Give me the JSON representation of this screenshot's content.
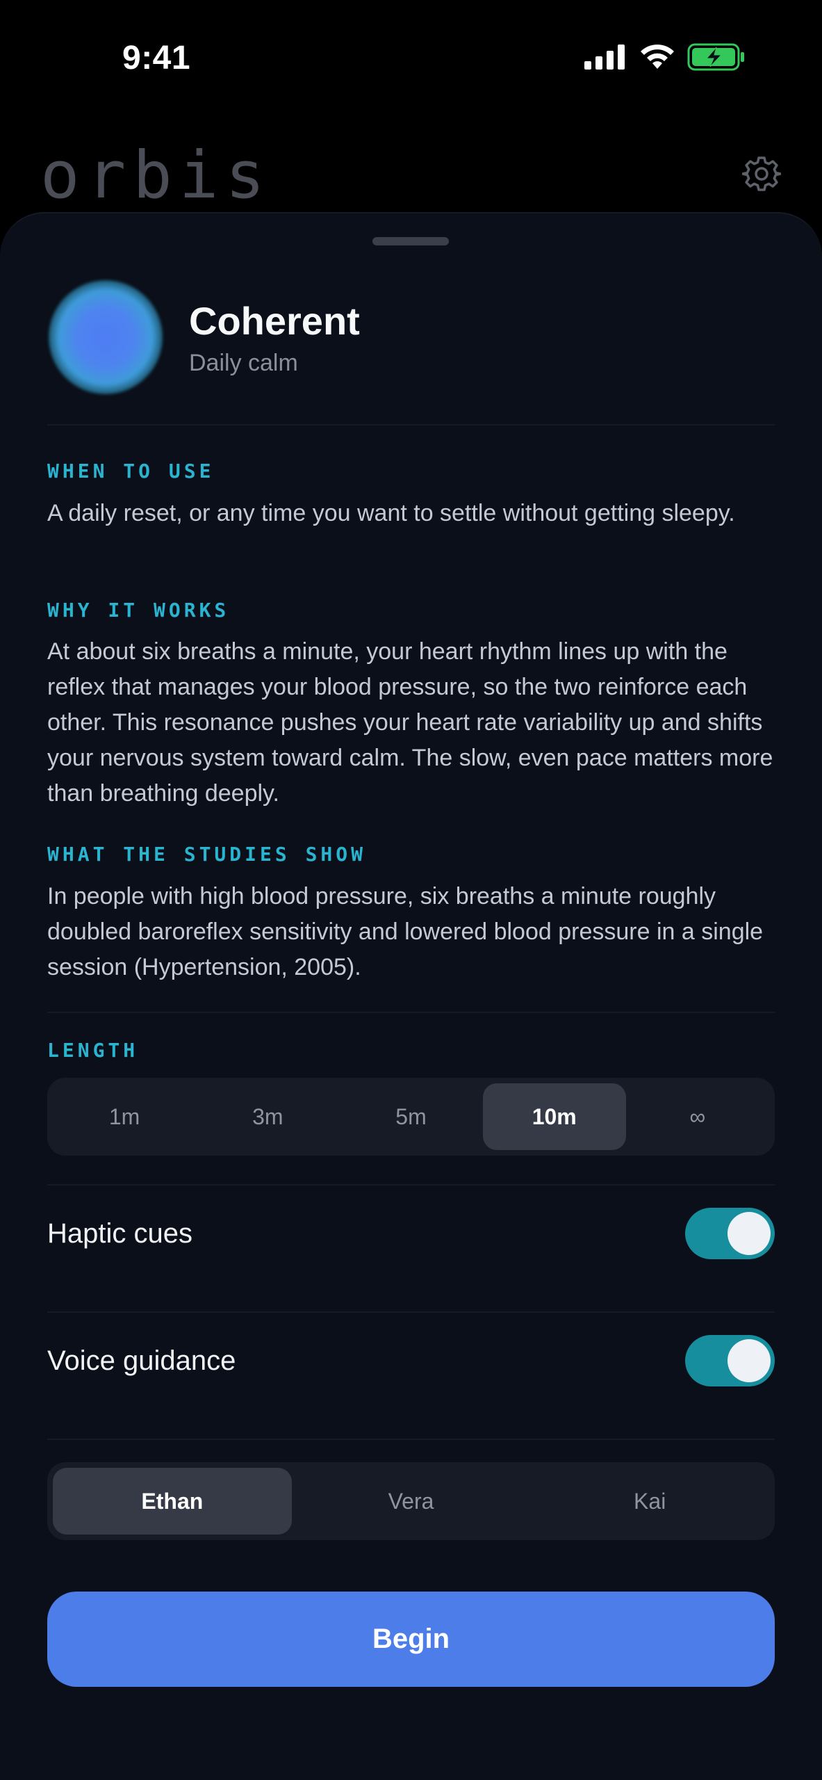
{
  "status_bar": {
    "time": "9:41"
  },
  "app": {
    "brand": "orbis",
    "settings_icon": "gear-icon"
  },
  "session": {
    "name": "Coherent",
    "subtitle": "Daily calm"
  },
  "sections": [
    {
      "label": "WHEN TO USE",
      "text": "A daily reset, or any time you want to settle without getting sleepy."
    },
    {
      "label": "WHY IT WORKS",
      "text": "At about six breaths a minute, your heart rhythm lines up with the reflex that manages your blood pressure, so the two reinforce each other. This resonance pushes your heart rate variability up and shifts your nervous system toward calm. The slow, even pace matters more than breathing deeply."
    },
    {
      "label": "WHAT THE STUDIES SHOW",
      "text": "In people with high blood pressure, six breaths a minute roughly doubled baroreflex sensitivity and lowered blood pressure in a single session (Hypertension, 2005)."
    }
  ],
  "length": {
    "label": "LENGTH",
    "options": [
      "1m",
      "3m",
      "5m",
      "10m",
      "∞"
    ],
    "selected": "10m"
  },
  "toggles": {
    "haptic": {
      "label": "Haptic cues",
      "on": true
    },
    "voice": {
      "label": "Voice guidance",
      "on": true
    }
  },
  "voices": {
    "options": [
      "Ethan",
      "Vera",
      "Kai"
    ],
    "selected": "Ethan"
  },
  "begin_label": "Begin",
  "colors": {
    "accent": "#4c7de8",
    "toggle_on": "#168e9e",
    "section_label": "#2ab4d0",
    "sheet": "#0b0f1a"
  }
}
